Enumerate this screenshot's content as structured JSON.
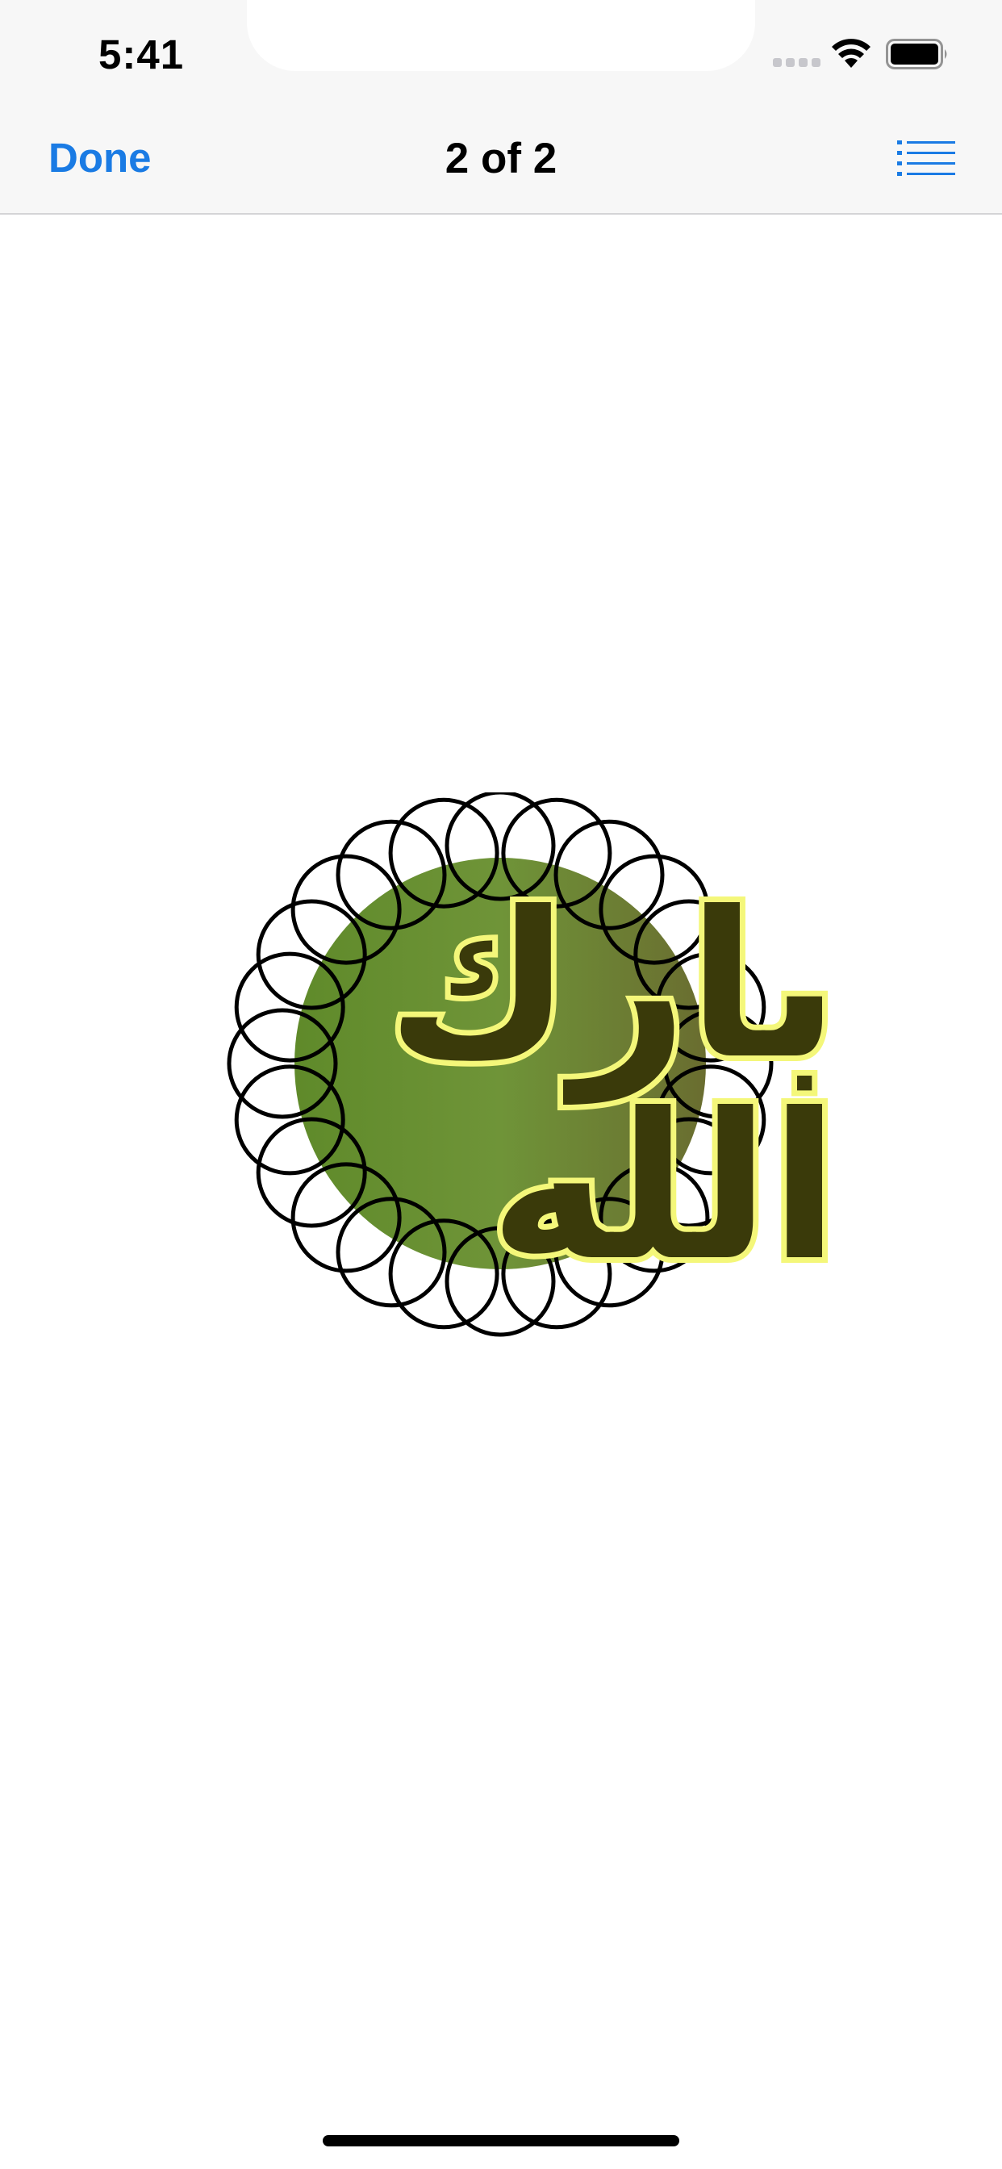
{
  "status_bar": {
    "time": "5:41",
    "icons": [
      "signal-icon",
      "wifi-icon",
      "battery-icon"
    ]
  },
  "nav_bar": {
    "done_label": "Done",
    "title": "2 of 2",
    "list_icon": "list-icon"
  },
  "content": {
    "image_text": "بارك الله"
  },
  "colors": {
    "accent": "#1a7be4",
    "nav_background": "#f7f7f7",
    "emblem_green": "#6b8e3a",
    "calligraphy_fill": "#3a3a0a",
    "calligraphy_outline": "#f4f77a"
  }
}
